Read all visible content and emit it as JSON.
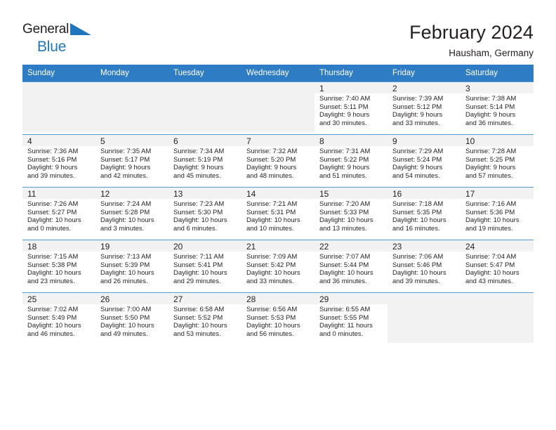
{
  "brand": {
    "name_top": "General",
    "name_bottom": "Blue",
    "accent_color": "#1f76bc"
  },
  "header": {
    "title": "February 2024",
    "location": "Hausham, Germany"
  },
  "calendar": {
    "header_bg": "#2e7cc4",
    "weekday_headers": [
      "Sunday",
      "Monday",
      "Tuesday",
      "Wednesday",
      "Thursday",
      "Friday",
      "Saturday"
    ],
    "weeks": [
      {
        "shaded": true,
        "days": [
          {
            "num": "",
            "sunrise": "",
            "sunset": "",
            "daylight_line1": "",
            "daylight_line2": ""
          },
          {
            "num": "",
            "sunrise": "",
            "sunset": "",
            "daylight_line1": "",
            "daylight_line2": ""
          },
          {
            "num": "",
            "sunrise": "",
            "sunset": "",
            "daylight_line1": "",
            "daylight_line2": ""
          },
          {
            "num": "",
            "sunrise": "",
            "sunset": "",
            "daylight_line1": "",
            "daylight_line2": ""
          },
          {
            "num": "1",
            "sunrise": "Sunrise: 7:40 AM",
            "sunset": "Sunset: 5:11 PM",
            "daylight_line1": "Daylight: 9 hours",
            "daylight_line2": "and 30 minutes."
          },
          {
            "num": "2",
            "sunrise": "Sunrise: 7:39 AM",
            "sunset": "Sunset: 5:12 PM",
            "daylight_line1": "Daylight: 9 hours",
            "daylight_line2": "and 33 minutes."
          },
          {
            "num": "3",
            "sunrise": "Sunrise: 7:38 AM",
            "sunset": "Sunset: 5:14 PM",
            "daylight_line1": "Daylight: 9 hours",
            "daylight_line2": "and 36 minutes."
          }
        ]
      },
      {
        "shaded": true,
        "days": [
          {
            "num": "4",
            "sunrise": "Sunrise: 7:36 AM",
            "sunset": "Sunset: 5:16 PM",
            "daylight_line1": "Daylight: 9 hours",
            "daylight_line2": "and 39 minutes."
          },
          {
            "num": "5",
            "sunrise": "Sunrise: 7:35 AM",
            "sunset": "Sunset: 5:17 PM",
            "daylight_line1": "Daylight: 9 hours",
            "daylight_line2": "and 42 minutes."
          },
          {
            "num": "6",
            "sunrise": "Sunrise: 7:34 AM",
            "sunset": "Sunset: 5:19 PM",
            "daylight_line1": "Daylight: 9 hours",
            "daylight_line2": "and 45 minutes."
          },
          {
            "num": "7",
            "sunrise": "Sunrise: 7:32 AM",
            "sunset": "Sunset: 5:20 PM",
            "daylight_line1": "Daylight: 9 hours",
            "daylight_line2": "and 48 minutes."
          },
          {
            "num": "8",
            "sunrise": "Sunrise: 7:31 AM",
            "sunset": "Sunset: 5:22 PM",
            "daylight_line1": "Daylight: 9 hours",
            "daylight_line2": "and 51 minutes."
          },
          {
            "num": "9",
            "sunrise": "Sunrise: 7:29 AM",
            "sunset": "Sunset: 5:24 PM",
            "daylight_line1": "Daylight: 9 hours",
            "daylight_line2": "and 54 minutes."
          },
          {
            "num": "10",
            "sunrise": "Sunrise: 7:28 AM",
            "sunset": "Sunset: 5:25 PM",
            "daylight_line1": "Daylight: 9 hours",
            "daylight_line2": "and 57 minutes."
          }
        ]
      },
      {
        "shaded": true,
        "days": [
          {
            "num": "11",
            "sunrise": "Sunrise: 7:26 AM",
            "sunset": "Sunset: 5:27 PM",
            "daylight_line1": "Daylight: 10 hours",
            "daylight_line2": "and 0 minutes."
          },
          {
            "num": "12",
            "sunrise": "Sunrise: 7:24 AM",
            "sunset": "Sunset: 5:28 PM",
            "daylight_line1": "Daylight: 10 hours",
            "daylight_line2": "and 3 minutes."
          },
          {
            "num": "13",
            "sunrise": "Sunrise: 7:23 AM",
            "sunset": "Sunset: 5:30 PM",
            "daylight_line1": "Daylight: 10 hours",
            "daylight_line2": "and 6 minutes."
          },
          {
            "num": "14",
            "sunrise": "Sunrise: 7:21 AM",
            "sunset": "Sunset: 5:31 PM",
            "daylight_line1": "Daylight: 10 hours",
            "daylight_line2": "and 10 minutes."
          },
          {
            "num": "15",
            "sunrise": "Sunrise: 7:20 AM",
            "sunset": "Sunset: 5:33 PM",
            "daylight_line1": "Daylight: 10 hours",
            "daylight_line2": "and 13 minutes."
          },
          {
            "num": "16",
            "sunrise": "Sunrise: 7:18 AM",
            "sunset": "Sunset: 5:35 PM",
            "daylight_line1": "Daylight: 10 hours",
            "daylight_line2": "and 16 minutes."
          },
          {
            "num": "17",
            "sunrise": "Sunrise: 7:16 AM",
            "sunset": "Sunset: 5:36 PM",
            "daylight_line1": "Daylight: 10 hours",
            "daylight_line2": "and 19 minutes."
          }
        ]
      },
      {
        "shaded": true,
        "days": [
          {
            "num": "18",
            "sunrise": "Sunrise: 7:15 AM",
            "sunset": "Sunset: 5:38 PM",
            "daylight_line1": "Daylight: 10 hours",
            "daylight_line2": "and 23 minutes."
          },
          {
            "num": "19",
            "sunrise": "Sunrise: 7:13 AM",
            "sunset": "Sunset: 5:39 PM",
            "daylight_line1": "Daylight: 10 hours",
            "daylight_line2": "and 26 minutes."
          },
          {
            "num": "20",
            "sunrise": "Sunrise: 7:11 AM",
            "sunset": "Sunset: 5:41 PM",
            "daylight_line1": "Daylight: 10 hours",
            "daylight_line2": "and 29 minutes."
          },
          {
            "num": "21",
            "sunrise": "Sunrise: 7:09 AM",
            "sunset": "Sunset: 5:42 PM",
            "daylight_line1": "Daylight: 10 hours",
            "daylight_line2": "and 33 minutes."
          },
          {
            "num": "22",
            "sunrise": "Sunrise: 7:07 AM",
            "sunset": "Sunset: 5:44 PM",
            "daylight_line1": "Daylight: 10 hours",
            "daylight_line2": "and 36 minutes."
          },
          {
            "num": "23",
            "sunrise": "Sunrise: 7:06 AM",
            "sunset": "Sunset: 5:46 PM",
            "daylight_line1": "Daylight: 10 hours",
            "daylight_line2": "and 39 minutes."
          },
          {
            "num": "24",
            "sunrise": "Sunrise: 7:04 AM",
            "sunset": "Sunset: 5:47 PM",
            "daylight_line1": "Daylight: 10 hours",
            "daylight_line2": "and 43 minutes."
          }
        ]
      },
      {
        "shaded": true,
        "days": [
          {
            "num": "25",
            "sunrise": "Sunrise: 7:02 AM",
            "sunset": "Sunset: 5:49 PM",
            "daylight_line1": "Daylight: 10 hours",
            "daylight_line2": "and 46 minutes."
          },
          {
            "num": "26",
            "sunrise": "Sunrise: 7:00 AM",
            "sunset": "Sunset: 5:50 PM",
            "daylight_line1": "Daylight: 10 hours",
            "daylight_line2": "and 49 minutes."
          },
          {
            "num": "27",
            "sunrise": "Sunrise: 6:58 AM",
            "sunset": "Sunset: 5:52 PM",
            "daylight_line1": "Daylight: 10 hours",
            "daylight_line2": "and 53 minutes."
          },
          {
            "num": "28",
            "sunrise": "Sunrise: 6:56 AM",
            "sunset": "Sunset: 5:53 PM",
            "daylight_line1": "Daylight: 10 hours",
            "daylight_line2": "and 56 minutes."
          },
          {
            "num": "29",
            "sunrise": "Sunrise: 6:55 AM",
            "sunset": "Sunset: 5:55 PM",
            "daylight_line1": "Daylight: 11 hours",
            "daylight_line2": "and 0 minutes."
          },
          {
            "num": "",
            "sunrise": "",
            "sunset": "",
            "daylight_line1": "",
            "daylight_line2": ""
          },
          {
            "num": "",
            "sunrise": "",
            "sunset": "",
            "daylight_line1": "",
            "daylight_line2": ""
          }
        ]
      }
    ]
  }
}
